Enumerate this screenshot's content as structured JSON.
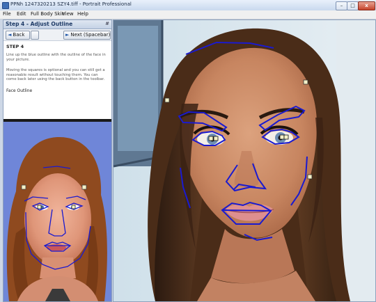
{
  "window": {
    "title": "PPNh 1247320213 SZY4.tiff - Portrait Professional",
    "min_label": "–",
    "max_label": "□",
    "close_label": "x"
  },
  "menu": {
    "items": [
      "File",
      "Edit",
      "Full Body Skin",
      "View",
      "Help"
    ]
  },
  "panel": {
    "title": "Step 4 - Adjust Outline",
    "pin": "#",
    "back_label": "Back",
    "next_label": "Next (Spacebar)",
    "step_label": "STEP 4",
    "para1": "Line up the blue outline with the outline of the face in your picture.",
    "para2": "Moving the squares is optional and you can still get a reasonable result without touching them. You can come back later using the back button in the toolbar.",
    "section": "Face Outline"
  },
  "colors": {
    "outline": "#1a1ad0",
    "handle": "#f4f1c8",
    "panel_header": "#c4d2e6",
    "reference_bg": "#6f86d8"
  }
}
